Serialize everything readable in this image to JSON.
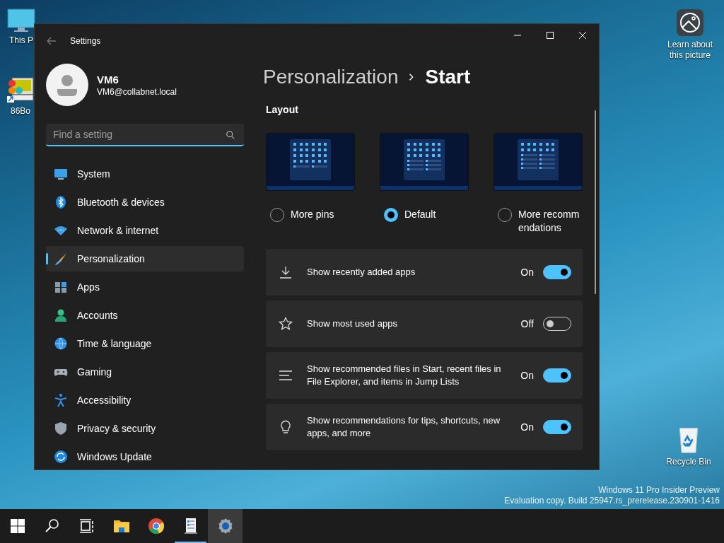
{
  "desktop": {
    "icons": [
      {
        "kind": "pc",
        "label": "This P"
      },
      {
        "kind": "app",
        "label": "86Bo"
      },
      {
        "kind": "info",
        "label": "Learn about this picture"
      },
      {
        "kind": "recycle",
        "label": "Recycle Bin"
      }
    ],
    "watermark": [
      "Windows 11 Pro Insider Preview",
      "Evaluation copy. Build 25947.rs_prerelease.230901-1416"
    ]
  },
  "window": {
    "title": "Settings"
  },
  "user": {
    "name": "VM6",
    "email": "VM6@collabnet.local"
  },
  "search": {
    "placeholder": "Find a setting"
  },
  "sidebar": {
    "items": [
      {
        "kind": "system",
        "label": "System",
        "selected": false
      },
      {
        "kind": "bluetooth",
        "label": "Bluetooth & devices",
        "selected": false
      },
      {
        "kind": "network",
        "label": "Network & internet",
        "selected": false
      },
      {
        "kind": "brush",
        "label": "Personalization",
        "selected": true
      },
      {
        "kind": "apps",
        "label": "Apps",
        "selected": false
      },
      {
        "kind": "accounts",
        "label": "Accounts",
        "selected": false
      },
      {
        "kind": "time",
        "label": "Time & language",
        "selected": false
      },
      {
        "kind": "gaming",
        "label": "Gaming",
        "selected": false
      },
      {
        "kind": "accessibility",
        "label": "Accessibility",
        "selected": false
      },
      {
        "kind": "privacy",
        "label": "Privacy & security",
        "selected": false
      },
      {
        "kind": "update",
        "label": "Windows Update",
        "selected": false
      }
    ]
  },
  "breadcrumb": {
    "parent": "Personalization",
    "current": "Start"
  },
  "layout": {
    "heading": "Layout",
    "options": [
      {
        "kind": "pins",
        "label": "More pins",
        "selected": false
      },
      {
        "kind": "default",
        "label": "Default",
        "selected": true
      },
      {
        "kind": "recs",
        "label": "More recommendations",
        "selected": false
      }
    ]
  },
  "toggles": [
    {
      "kind": "download",
      "label": "Show recently added apps",
      "state": "On",
      "on": true
    },
    {
      "kind": "star",
      "label": "Show most used apps",
      "state": "Off",
      "on": false
    },
    {
      "kind": "lines",
      "label": "Show recommended files in Start, recent files in File Explorer, and items in Jump Lists",
      "state": "On",
      "on": true
    },
    {
      "kind": "bulb",
      "label": "Show recommendations for tips, shortcuts, new apps, and more",
      "state": "On",
      "on": true
    }
  ],
  "taskbar": {
    "items": [
      {
        "kind": "start",
        "running": false,
        "active": false
      },
      {
        "kind": "search",
        "running": false,
        "active": false
      },
      {
        "kind": "taskview",
        "running": false,
        "active": false
      },
      {
        "kind": "explorer",
        "running": false,
        "active": false
      },
      {
        "kind": "chrome",
        "running": false,
        "active": false
      },
      {
        "kind": "notes",
        "running": true,
        "active": false
      },
      {
        "kind": "settings",
        "running": false,
        "active": true
      }
    ]
  }
}
